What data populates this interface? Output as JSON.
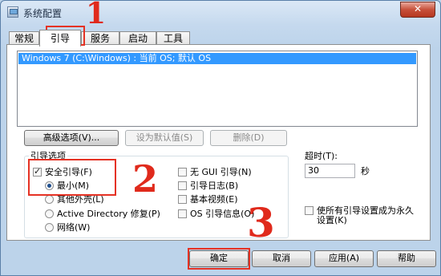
{
  "window": {
    "title": "系统配置",
    "close_glyph": "✕"
  },
  "tabs": [
    {
      "label": "常规"
    },
    {
      "label": "引导"
    },
    {
      "label": "服务"
    },
    {
      "label": "启动"
    },
    {
      "label": "工具"
    }
  ],
  "os_list": {
    "items": [
      "Windows 7 (C:\\Windows) : 当前 OS; 默认 OS"
    ]
  },
  "buttons": {
    "advanced": "高级选项(V)...",
    "set_default": "设为默认值(S)",
    "delete": "删除(D)",
    "ok": "确定",
    "cancel": "取消",
    "apply": "应用(A)",
    "help": "帮助"
  },
  "boot_options": {
    "title": "引导选项",
    "safe_boot": {
      "label": "安全引导(F)",
      "checked": true
    },
    "radios": [
      {
        "label": "最小(M)",
        "selected": true
      },
      {
        "label": "其他外壳(L)",
        "selected": false
      },
      {
        "label": "Active Directory 修复(P)",
        "selected": false
      },
      {
        "label": "网络(W)",
        "selected": false
      }
    ],
    "checks": [
      {
        "label": "无 GUI 引导(N)",
        "checked": false
      },
      {
        "label": "引导日志(B)",
        "checked": false
      },
      {
        "label": "基本视频(E)",
        "checked": false
      },
      {
        "label": "OS 引导信息(O)",
        "checked": false
      }
    ]
  },
  "timeout": {
    "label": "超时(T):",
    "value": "30",
    "unit": "秒"
  },
  "make_permanent": {
    "label_line1": "使所有引导设置成为永久",
    "label_line2": "设置(K)",
    "checked": false
  },
  "annotations": {
    "mark1": "1",
    "mark2": "2",
    "mark3": "3"
  },
  "colors": {
    "selection": "#3399ff",
    "annotation": "#e53224"
  }
}
